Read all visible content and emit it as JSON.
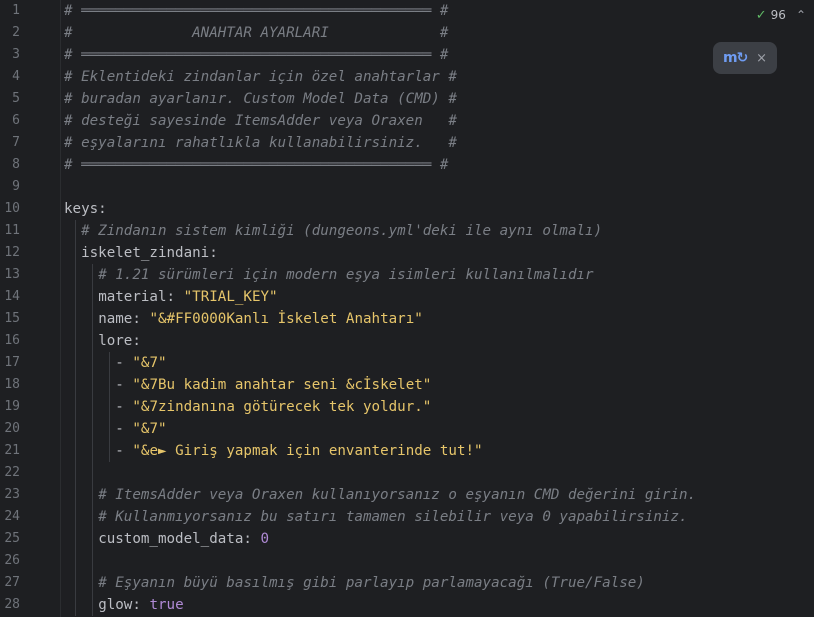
{
  "inspection": {
    "count": "96"
  },
  "popup": {
    "close": "×"
  },
  "lines": [
    {
      "n": "1",
      "indent": 0,
      "parts": [
        [
          "c-comment",
          "# ═════════════════════════════════════════ #"
        ]
      ]
    },
    {
      "n": "2",
      "indent": 0,
      "parts": [
        [
          "c-comment",
          "#              ANAHTAR AYARLARI             #"
        ]
      ]
    },
    {
      "n": "3",
      "indent": 0,
      "parts": [
        [
          "c-comment",
          "# ═════════════════════════════════════════ #"
        ]
      ]
    },
    {
      "n": "4",
      "indent": 0,
      "parts": [
        [
          "c-comment",
          "# Eklentideki zindanlar için özel anahtarlar #"
        ]
      ]
    },
    {
      "n": "5",
      "indent": 0,
      "parts": [
        [
          "c-comment",
          "# buradan ayarlanır. Custom Model Data (CMD) #"
        ]
      ]
    },
    {
      "n": "6",
      "indent": 0,
      "parts": [
        [
          "c-comment",
          "# desteği sayesinde ItemsAdder veya Oraxen   #"
        ]
      ]
    },
    {
      "n": "7",
      "indent": 0,
      "parts": [
        [
          "c-comment",
          "# eşyalarını rahatlıkla kullanabilirsiniz.   #"
        ]
      ]
    },
    {
      "n": "8",
      "indent": 0,
      "parts": [
        [
          "c-comment",
          "# ═════════════════════════════════════════ #"
        ]
      ]
    },
    {
      "n": "9",
      "indent": 0,
      "parts": []
    },
    {
      "n": "10",
      "indent": 0,
      "parts": [
        [
          "c-plainkey",
          "keys"
        ],
        [
          "c-punc",
          ":"
        ]
      ]
    },
    {
      "n": "11",
      "indent": 1,
      "parts": [
        [
          "c-comment",
          "# Zindanın sistem kimliği (dungeons.yml'deki ile aynı olmalı)"
        ]
      ]
    },
    {
      "n": "12",
      "indent": 1,
      "parts": [
        [
          "c-plainkey",
          "iskelet_zindani"
        ],
        [
          "c-punc",
          ":"
        ]
      ]
    },
    {
      "n": "13",
      "indent": 2,
      "parts": [
        [
          "c-comment",
          "# 1.21 sürümleri için modern eşya isimleri kullanılmalıdır"
        ]
      ]
    },
    {
      "n": "14",
      "indent": 2,
      "parts": [
        [
          "c-plainkey",
          "material"
        ],
        [
          "c-punc",
          ": "
        ],
        [
          "c-str",
          "\"TRIAL_KEY\""
        ]
      ]
    },
    {
      "n": "15",
      "indent": 2,
      "parts": [
        [
          "c-plainkey",
          "name"
        ],
        [
          "c-punc",
          ": "
        ],
        [
          "c-str",
          "\"&#FF0000Kanlı İskelet Anahtarı\""
        ]
      ]
    },
    {
      "n": "16",
      "indent": 2,
      "parts": [
        [
          "c-plainkey",
          "lore"
        ],
        [
          "c-punc",
          ":"
        ]
      ]
    },
    {
      "n": "17",
      "indent": 3,
      "parts": [
        [
          "c-punc",
          "- "
        ],
        [
          "c-str",
          "\"&7\""
        ]
      ]
    },
    {
      "n": "18",
      "indent": 3,
      "parts": [
        [
          "c-punc",
          "- "
        ],
        [
          "c-str",
          "\"&7Bu kadim anahtar seni &cİskelet\""
        ]
      ]
    },
    {
      "n": "19",
      "indent": 3,
      "parts": [
        [
          "c-punc",
          "- "
        ],
        [
          "c-str",
          "\"&7zindanına götürecek tek yoldur.\""
        ]
      ]
    },
    {
      "n": "20",
      "indent": 3,
      "parts": [
        [
          "c-punc",
          "- "
        ],
        [
          "c-str",
          "\"&7\""
        ]
      ]
    },
    {
      "n": "21",
      "indent": 3,
      "parts": [
        [
          "c-punc",
          "- "
        ],
        [
          "c-str",
          "\"&e► Giriş yapmak için envanterinde tut!\""
        ]
      ]
    },
    {
      "n": "22",
      "indent": 2,
      "parts": []
    },
    {
      "n": "23",
      "indent": 2,
      "parts": [
        [
          "c-comment",
          "# ItemsAdder veya Oraxen kullanıyorsanız o eşyanın CMD değerini girin."
        ]
      ]
    },
    {
      "n": "24",
      "indent": 2,
      "parts": [
        [
          "c-comment",
          "# Kullanmıyorsanız bu satırı tamamen silebilir veya 0 yapabilirsiniz."
        ]
      ]
    },
    {
      "n": "25",
      "indent": 2,
      "parts": [
        [
          "c-plainkey",
          "custom_model_data"
        ],
        [
          "c-punc",
          ": "
        ],
        [
          "c-num",
          "0"
        ]
      ]
    },
    {
      "n": "26",
      "indent": 2,
      "parts": []
    },
    {
      "n": "27",
      "indent": 2,
      "parts": [
        [
          "c-comment",
          "# Eşyanın büyü basılmış gibi parlayıp parlamayacağı (True/False)"
        ]
      ]
    },
    {
      "n": "28",
      "indent": 2,
      "parts": [
        [
          "c-plainkey",
          "glow"
        ],
        [
          "c-punc",
          ": "
        ],
        [
          "c-bool",
          "true"
        ]
      ]
    }
  ]
}
